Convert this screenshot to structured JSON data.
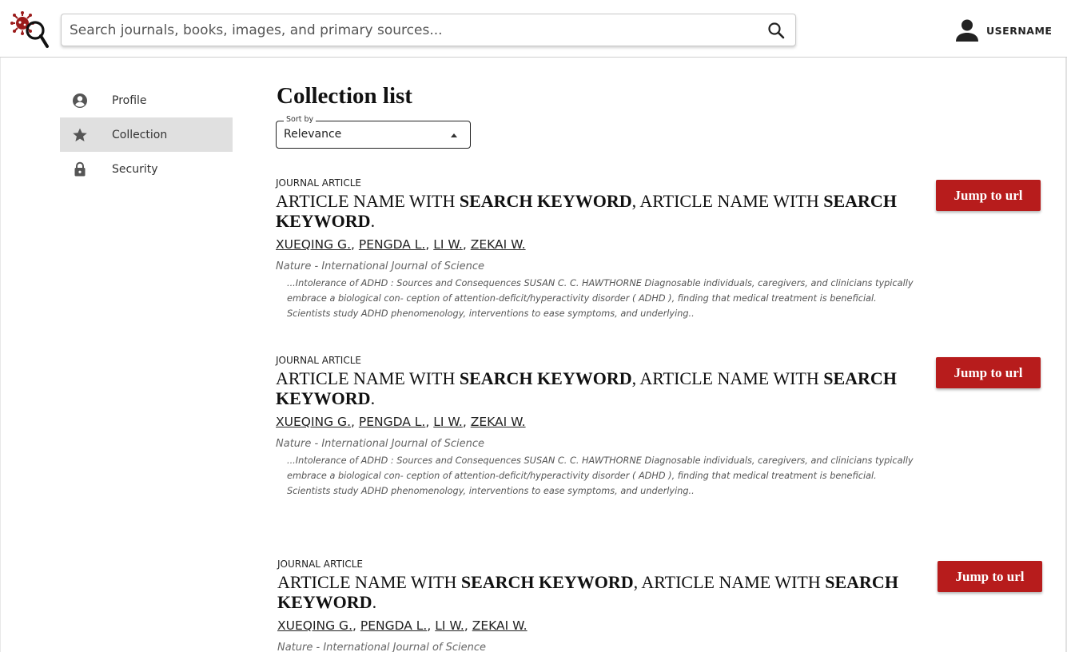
{
  "header": {
    "logo_icon": "virus-magnifier-logo",
    "search_placeholder": "Search journals, books, images, and primary sources...",
    "search_icon": "search-icon",
    "username": "USERNAME",
    "user_icon": "person-icon"
  },
  "sidebar": {
    "items": [
      {
        "label": "Profile",
        "icon": "account-circle-icon",
        "active": false
      },
      {
        "label": "Collection",
        "icon": "star-icon",
        "active": true
      },
      {
        "label": "Security",
        "icon": "lock-icon",
        "active": false
      }
    ]
  },
  "main": {
    "title": "Collection list",
    "sort": {
      "legend": "Sort by",
      "value": "Relevance"
    },
    "articles": [
      {
        "type": "JOURNAL ARTICLE",
        "title_part1": "ARTICLE NAME WITH ",
        "title_keyword1": "SEARCH KEYWORD",
        "title_part2": ", ARTICLE NAME WITH ",
        "title_keyword2": "SEARCH KEYWORD",
        "title_end": ".",
        "authors": [
          "XUEQING G.",
          "PENGDA L.",
          "LI W.",
          "ZEKAI W."
        ],
        "journal": "Nature - International Journal of Science",
        "snippet": "...Intolerance of ADHD : Sources and Consequences SUSAN C. C. HAWTHORNE Diagnosable individuals, caregivers, and clinicians typically embrace a biological con- ception of attention-deficit/hyperactivity disorder ( ADHD ), finding that medical treatment is beneficial. Scientists study ADHD phenomenology, interventions to ease symptoms, and underlying..",
        "button": "Jump to url"
      },
      {
        "type": "JOURNAL ARTICLE",
        "title_part1": "ARTICLE NAME WITH ",
        "title_keyword1": "SEARCH KEYWORD",
        "title_part2": ", ARTICLE NAME WITH ",
        "title_keyword2": "SEARCH KEYWORD",
        "title_end": ".",
        "authors": [
          "XUEQING G.",
          "PENGDA L.",
          "LI W.",
          "ZEKAI W."
        ],
        "journal": "Nature - International Journal of Science",
        "snippet": "...Intolerance of ADHD : Sources and Consequences SUSAN C. C. HAWTHORNE Diagnosable individuals, caregivers, and clinicians typically embrace a biological con- ception of attention-deficit/hyperactivity disorder ( ADHD ), finding that medical treatment is beneficial. Scientists study ADHD phenomenology, interventions to ease symptoms, and underlying..",
        "button": "Jump to url"
      },
      {
        "type": "JOURNAL ARTICLE",
        "title_part1": "ARTICLE NAME WITH ",
        "title_keyword1": "SEARCH KEYWORD",
        "title_part2": ", ARTICLE NAME WITH ",
        "title_keyword2": "SEARCH KEYWORD",
        "title_end": ".",
        "authors": [
          "XUEQING G.",
          "PENGDA L.",
          "LI W.",
          "ZEKAI W."
        ],
        "journal": "Nature - International Journal of Science",
        "snippet": "",
        "button": "Jump to url"
      }
    ]
  },
  "colors": {
    "accent": "#b71c1c",
    "sidebar_active": "#e0e0e0",
    "logo": "#9b1b1b"
  }
}
